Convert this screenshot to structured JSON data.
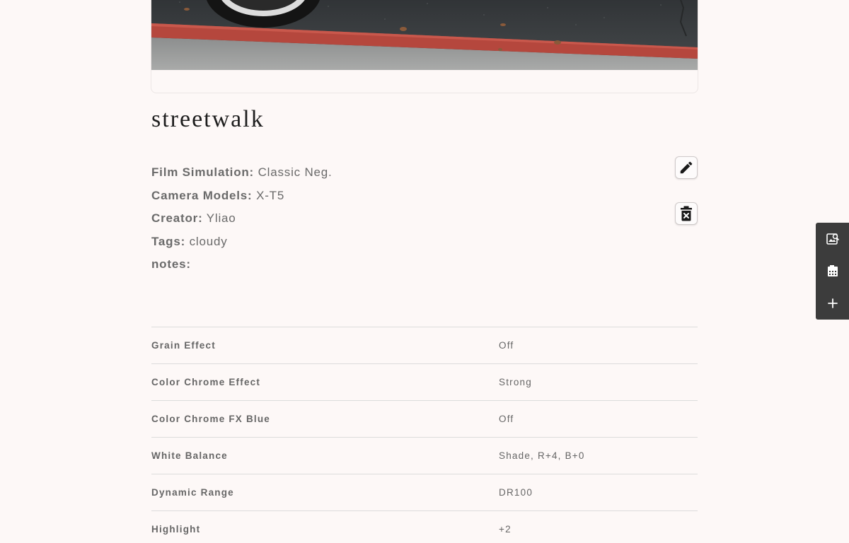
{
  "recipe": {
    "title": "streetwalk"
  },
  "meta": {
    "film_simulation": {
      "label": "Film Simulation:",
      "value": "Classic Neg."
    },
    "camera_models": {
      "label": "Camera Models:",
      "value": "X-T5"
    },
    "creator": {
      "label": "Creator:",
      "value": "Yliao"
    },
    "tags": {
      "label": "Tags:",
      "value": "cloudy"
    },
    "notes": {
      "label": "notes:",
      "value": ""
    }
  },
  "actions": {
    "edit_icon": "pencil-icon",
    "delete_icon": "trash-x-icon"
  },
  "settings": [
    {
      "name": "Grain Effect",
      "value": "Off"
    },
    {
      "name": "Color Chrome Effect",
      "value": "Strong"
    },
    {
      "name": "Color Chrome FX Blue",
      "value": "Off"
    },
    {
      "name": "White Balance",
      "value": "Shade, R+4, B+0"
    },
    {
      "name": "Dynamic Range",
      "value": "DR100"
    },
    {
      "name": "Highlight",
      "value": "+2"
    }
  ],
  "side_toolbar": {
    "items": [
      "image-search-icon",
      "film-icon",
      "plus-icon"
    ]
  },
  "colors": {
    "background": "#fdf8f7",
    "toolbar": "#3c3c3c",
    "curb_red": "#b5473d",
    "asphalt": "#3b3f42"
  }
}
